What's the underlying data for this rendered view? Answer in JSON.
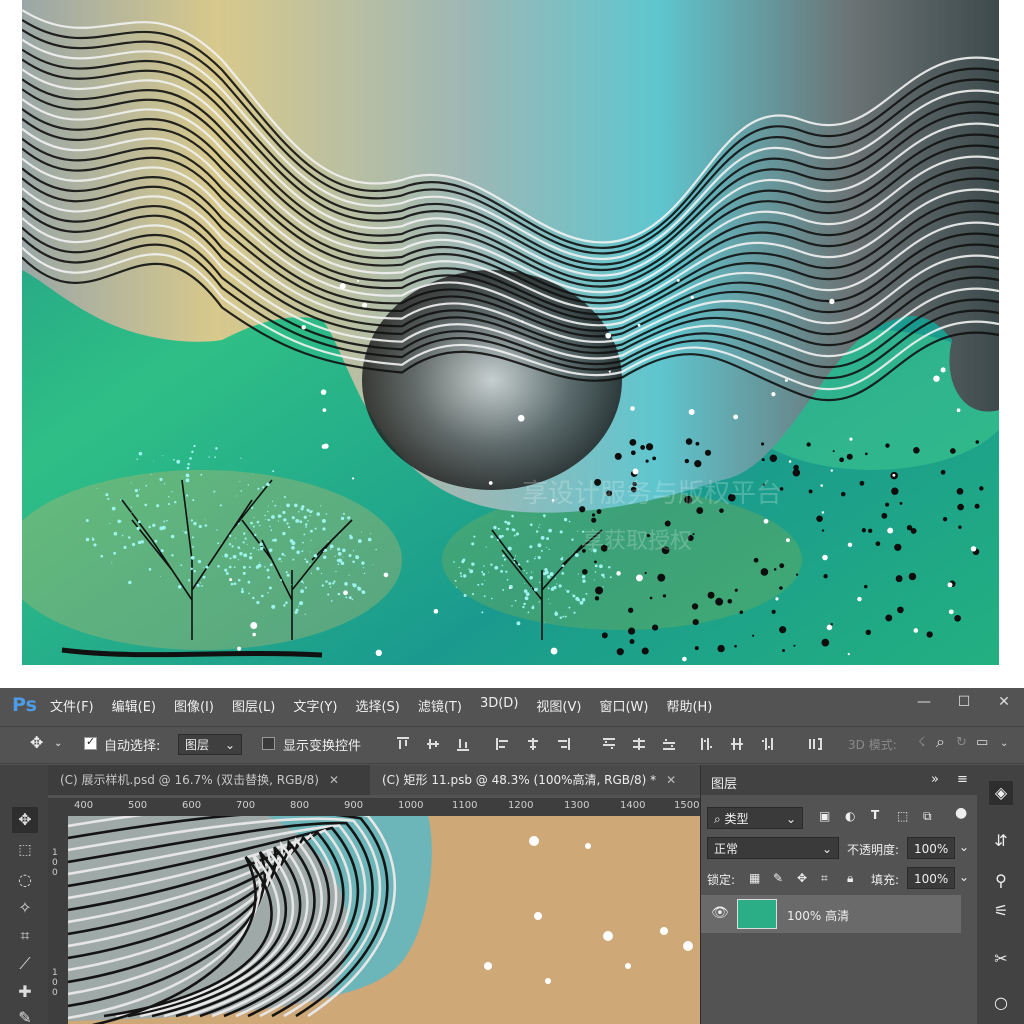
{
  "menubar": {
    "logo": "Ps",
    "items": [
      "文件(F)",
      "编辑(E)",
      "图像(I)",
      "图层(L)",
      "文字(Y)",
      "选择(S)",
      "滤镜(T)",
      "3D(D)",
      "视图(V)",
      "窗口(W)",
      "帮助(H)"
    ],
    "window_buttons": [
      "—",
      "☐",
      "✕"
    ]
  },
  "options": {
    "auto_select_label": "自动选择:",
    "auto_select_value": "图层",
    "show_transform_label": "显示变换控件",
    "mode_3d_label": "3D 模式:"
  },
  "tabs": [
    {
      "label": "(C) 展示样机.psd @ 16.7% (双击替换, RGB/8)",
      "close": "✕"
    },
    {
      "label": "(C) 矩形 11.psb @ 48.3% (100%高清, RGB/8) *",
      "close": "✕"
    }
  ],
  "ruler": {
    "h_ticks": [
      "400",
      "500",
      "600",
      "700",
      "800",
      "900",
      "1000",
      "1100",
      "1200",
      "1300",
      "1400",
      "1500"
    ],
    "v_ticks": [
      "100",
      "100"
    ]
  },
  "layers_panel": {
    "title": "图层",
    "expand_icon": "»",
    "menu_icon": "≡",
    "filter_type": "类型",
    "blend_mode": "正常",
    "opacity_label": "不透明度:",
    "opacity_value": "100%",
    "lock_label": "锁定:",
    "fill_label": "填充:",
    "fill_value": "100%",
    "layer_name": "100% 高清"
  },
  "watermark": {
    "line1": "享设计服务与版权平台",
    "line2": "享获取授权"
  },
  "colors": {
    "ps_bg": "#535353",
    "ps_dark": "#424242",
    "layer_thumb": "#2bad86",
    "canvas_beige": "#cfa878",
    "ps_logo": "#4d9be6"
  }
}
